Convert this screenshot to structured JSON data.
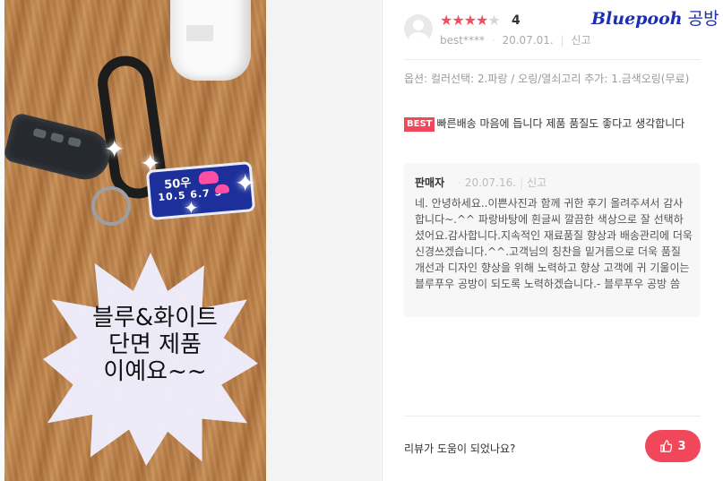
{
  "photo": {
    "caption_lines": [
      "블루&화이트",
      "단면 제품",
      "이예요~~"
    ],
    "tag_line1": "50우",
    "tag_line2": "10.5 6.7 5"
  },
  "review": {
    "rating": 4,
    "rating_max": 5,
    "rating_label": "4",
    "author": "best****",
    "date": "20.07.01.",
    "report_label": "신고",
    "brand_en": "Bluepooh",
    "brand_ko": "공방",
    "options_text": "옵션: 컬러선택: 2.파랑 / 오링/열쇠고리 추가: 1.금색오링(무료)",
    "best_badge": "BEST",
    "body_text": "빠른배송 마음에 듭니다 제품 품질도 좋다고 생각합니다",
    "reply": {
      "author": "판매자",
      "date": "20.07.16.",
      "report_label": "신고",
      "text": "네. 안녕하세요..이쁜사진과 함께 귀한 후기 올려주셔서 감사합니다~.^^ 파랑바탕에 흰글씨 깔끔한 색상으로 잘 선택하셨어요.감사합니다.지속적인 재료품질 향상과 배송관리에 더욱신경쓰겠습니다.^^.고객님의 칭찬을 밑거름으로 더욱 품질 개선과 디자인 향상을 위해 노력하고 향상 고객에 귀 기울이는 블루푸우 공방이 되도록 노력하겠습니다.- 블루푸우 공방 씀"
    },
    "helpful_question": "리뷰가 도움이 되었나요?",
    "helpful_count": "3"
  },
  "colors": {
    "accent": "#f0485a",
    "brand": "#1d2fb0"
  },
  "icons": {
    "like": "thumbs-up-icon",
    "avatar": "user-avatar-icon",
    "star": "star-icon"
  }
}
